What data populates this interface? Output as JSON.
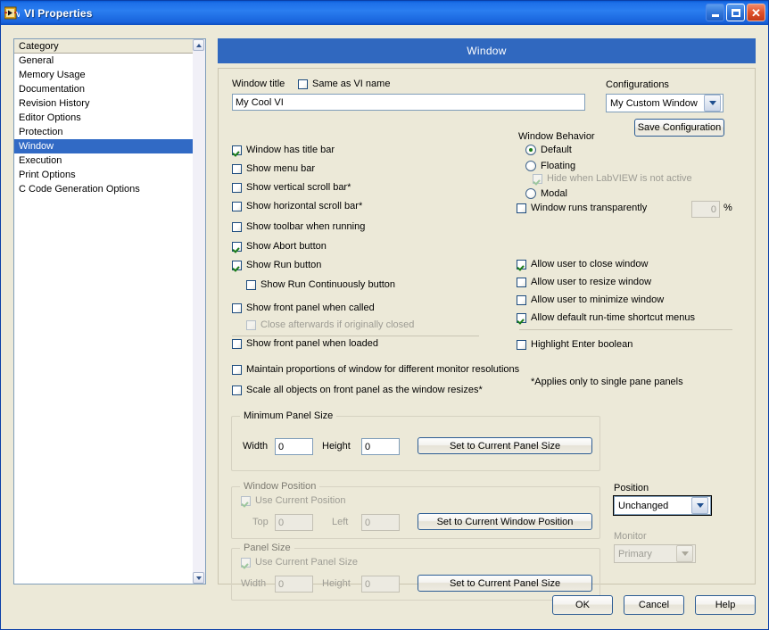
{
  "window": {
    "title": "VI Properties",
    "icon": "labview-vi-icon",
    "controls": {
      "minimize": "minimize-icon",
      "maximize": "maximize-icon",
      "close": "close-icon"
    }
  },
  "category": {
    "header": "Category",
    "items": [
      {
        "label": "General",
        "selected": false
      },
      {
        "label": "Memory Usage",
        "selected": false
      },
      {
        "label": "Documentation",
        "selected": false
      },
      {
        "label": "Revision History",
        "selected": false
      },
      {
        "label": "Editor Options",
        "selected": false
      },
      {
        "label": "Protection",
        "selected": false
      },
      {
        "label": "Window",
        "selected": true
      },
      {
        "label": "Execution",
        "selected": false
      },
      {
        "label": "Print Options",
        "selected": false
      },
      {
        "label": "C Code Generation Options",
        "selected": false
      }
    ],
    "scroll_up": "scroll-up-icon",
    "scroll_down": "scroll-down-icon"
  },
  "page": {
    "heading": "Window",
    "window_title_label": "Window title",
    "same_as_vi_name_label": "Same as VI name",
    "same_as_vi_name_checked": false,
    "window_title_value": "My Cool VI",
    "left_checkboxes": [
      {
        "label": "Window has title bar",
        "checked": true,
        "disabled": false,
        "indent": 0
      },
      {
        "label": "Show menu bar",
        "checked": false,
        "disabled": false,
        "indent": 0
      },
      {
        "label": "Show vertical scroll bar*",
        "checked": false,
        "disabled": false,
        "indent": 0
      },
      {
        "label": "Show horizontal scroll bar*",
        "checked": false,
        "disabled": false,
        "indent": 0
      },
      {
        "label": "Show toolbar when running",
        "checked": false,
        "disabled": false,
        "indent": 0
      },
      {
        "label": "Show Abort button",
        "checked": true,
        "disabled": false,
        "indent": 0
      },
      {
        "label": "Show Run button",
        "checked": true,
        "disabled": false,
        "indent": 0
      },
      {
        "label": "Show Run Continuously button",
        "checked": false,
        "disabled": false,
        "indent": 1
      }
    ],
    "left_checkboxes_2": [
      {
        "label": "Show front panel when called",
        "checked": false,
        "disabled": false,
        "indent": 0
      },
      {
        "label": "Close afterwards if originally closed",
        "checked": false,
        "disabled": true,
        "indent": 1
      },
      {
        "label": "Show front panel when loaded",
        "checked": false,
        "disabled": false,
        "indent": 0
      }
    ],
    "left_checkboxes_3": [
      {
        "label": "Maintain proportions of window for different monitor resolutions",
        "checked": false,
        "disabled": false
      },
      {
        "label": "Scale all objects on front panel as the window resizes*",
        "checked": false,
        "disabled": false
      }
    ],
    "footnote": "*Applies only to single pane panels",
    "configurations": {
      "label": "Configurations",
      "value": "My Custom Window",
      "save_button": "Save Configuration"
    },
    "window_behavior": {
      "label": "Window Behavior",
      "options": [
        {
          "label": "Default",
          "selected": true
        },
        {
          "label": "Floating",
          "selected": false
        },
        {
          "label": "Modal",
          "selected": false
        }
      ],
      "hide_when_inactive": {
        "label": "Hide when LabVIEW is not active",
        "checked": true,
        "disabled": true
      },
      "transparency": {
        "label": "Window runs transparently",
        "checked": false,
        "value": "0",
        "unit": "%"
      }
    },
    "allow_checkboxes": [
      {
        "label": "Allow user to close window",
        "checked": true
      },
      {
        "label": "Allow user to resize window",
        "checked": false
      },
      {
        "label": "Allow user to minimize window",
        "checked": false
      },
      {
        "label": "Allow default run-time shortcut menus",
        "checked": true
      }
    ],
    "highlight_enter": {
      "label": "Highlight Enter boolean",
      "checked": false
    },
    "minimum_panel_size": {
      "title": "Minimum Panel Size",
      "width_label": "Width",
      "width_value": "0",
      "height_label": "Height",
      "height_value": "0",
      "button": "Set to Current Panel Size"
    },
    "window_position": {
      "title": "Window Position",
      "use_current_label": "Use Current Position",
      "use_current_checked": true,
      "top_label": "Top",
      "top_value": "0",
      "left_label": "Left",
      "left_value": "0",
      "button": "Set to Current Window Position"
    },
    "panel_size": {
      "title": "Panel Size",
      "use_current_label": "Use Current Panel Size",
      "use_current_checked": true,
      "width_label": "Width",
      "width_value": "0",
      "height_label": "Height",
      "height_value": "0",
      "button": "Set to Current Panel Size"
    },
    "position": {
      "label": "Position",
      "value": "Unchanged"
    },
    "monitor": {
      "label": "Monitor",
      "value": "Primary"
    }
  },
  "footer": {
    "ok": "OK",
    "cancel": "Cancel",
    "help": "Help"
  },
  "colors": {
    "titlebar_blue": "#1d6fe8",
    "page_header_blue": "#3068bf",
    "selection_blue": "#316ac5",
    "dialog_face": "#ece9d8",
    "check_green": "#1a7c1a"
  }
}
